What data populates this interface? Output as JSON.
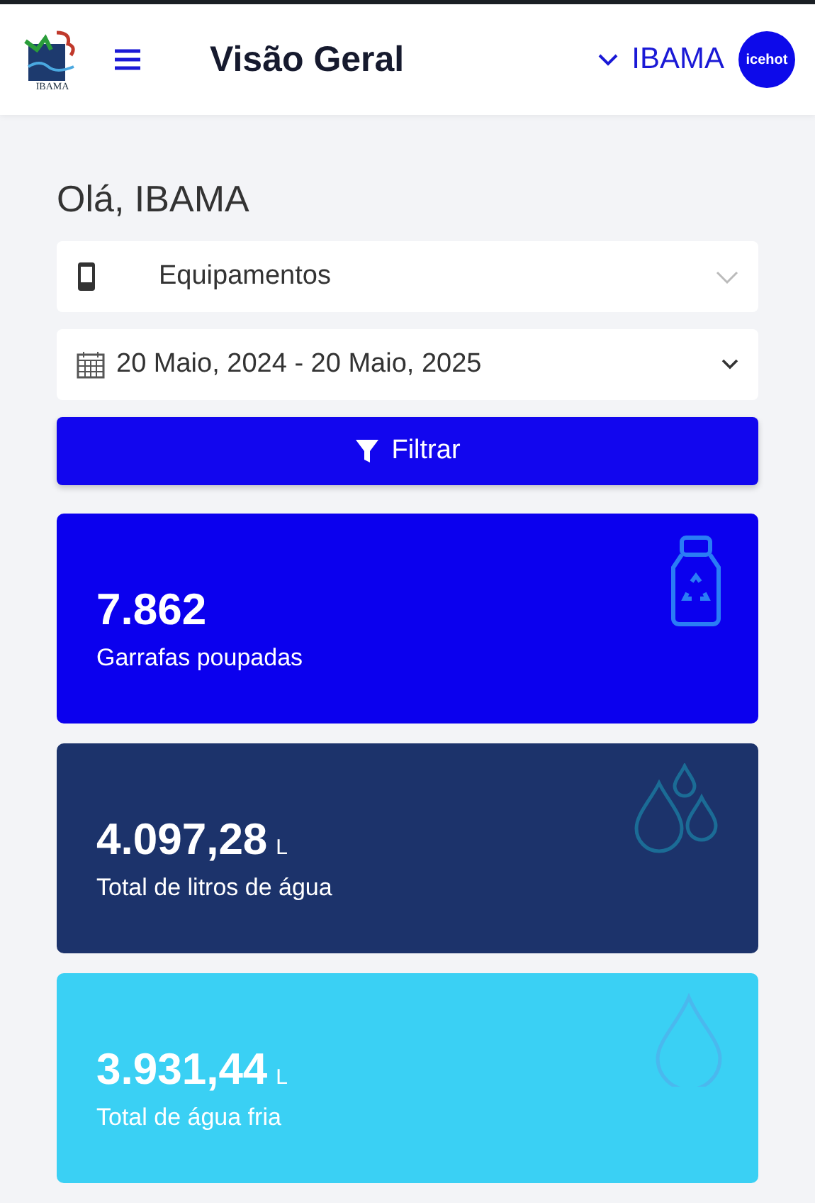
{
  "header": {
    "logo_text": "IBAMA",
    "title": "Visão Geral",
    "user": "IBAMA",
    "avatar_text": "icehot"
  },
  "greeting": "Olá, IBAMA",
  "device_select": {
    "value": "Equipamentos"
  },
  "date_range": {
    "value": "20 Maio, 2024 - 20 Maio, 2025"
  },
  "filter_button": "Filtrar",
  "cards": [
    {
      "kind": "bottle",
      "value": "7.862",
      "label": "Garrafas poupadas",
      "color": "#0b00ee"
    },
    {
      "kind": "drops",
      "value": "4.097,28",
      "unit": "L",
      "label": "Total de litros de água",
      "color": "#1c336b"
    },
    {
      "kind": "drop",
      "value": "3.931,44",
      "unit": "L",
      "label": "Total de água fria",
      "color": "#3ad0f4"
    }
  ]
}
